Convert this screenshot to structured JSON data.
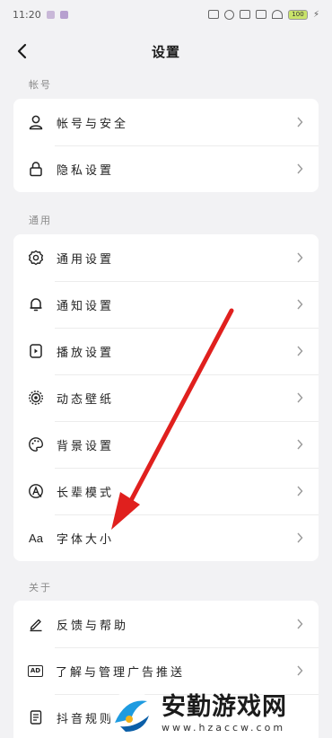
{
  "status_bar": {
    "time": "11:20",
    "battery": "100"
  },
  "header": {
    "title": "设置"
  },
  "sections": [
    {
      "label": "帐号",
      "items": [
        {
          "label": "帐号与安全",
          "icon": "user-icon"
        },
        {
          "label": "隐私设置",
          "icon": "lock-icon"
        }
      ]
    },
    {
      "label": "通用",
      "items": [
        {
          "label": "通用设置",
          "icon": "gear-icon"
        },
        {
          "label": "通知设置",
          "icon": "bell-icon"
        },
        {
          "label": "播放设置",
          "icon": "play-icon"
        },
        {
          "label": "动态壁纸",
          "icon": "wallpaper-icon"
        },
        {
          "label": "背景设置",
          "icon": "palette-icon"
        },
        {
          "label": "长辈模式",
          "icon": "elder-mode-icon"
        },
        {
          "label": "字体大小",
          "icon": "font-size-icon",
          "icon_text": "Aa"
        }
      ]
    },
    {
      "label": "关于",
      "items": [
        {
          "label": "反馈与帮助",
          "icon": "edit-icon"
        },
        {
          "label": "了解与管理广告推送",
          "icon": "ad-icon",
          "icon_text": "AD"
        },
        {
          "label": "抖音规则",
          "icon": "document-icon"
        }
      ]
    }
  ],
  "watermark": {
    "name": "安勤游戏网",
    "url": "www.hzaccw.com"
  },
  "colors": {
    "background": "#f2f2f4",
    "card": "#ffffff",
    "arrow": "#e0201e"
  }
}
